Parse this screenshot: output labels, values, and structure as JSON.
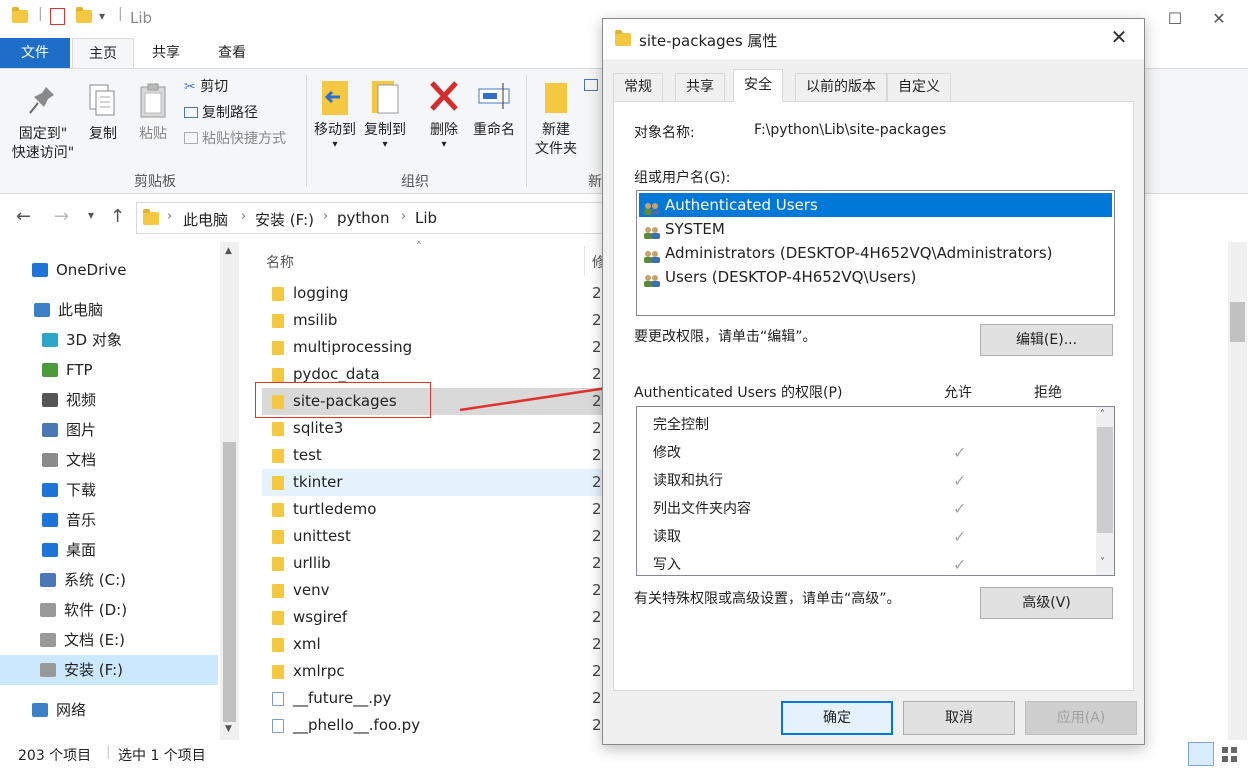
{
  "window": {
    "title": "Lib",
    "minimize": "—",
    "maximize": "☐",
    "close": "✕"
  },
  "ribbon_tabs": [
    "文件",
    "主页",
    "共享",
    "查看"
  ],
  "ribbon": {
    "pin": [
      "固定到\"",
      "快速访问\""
    ],
    "copy": "复制",
    "paste": "粘贴",
    "cut": "剪切",
    "copy_path": "复制路径",
    "paste_shortcut": "粘贴快捷方式",
    "clipboard_group": "剪贴板",
    "move_to": "移动到",
    "copy_to": "复制到",
    "delete": "删除",
    "rename": "重命名",
    "organize_group": "组织",
    "new_folder": [
      "新建",
      "文件夹"
    ],
    "new_group": "新"
  },
  "address": {
    "crumbs": [
      "此电脑",
      "安装 (F:)",
      "python",
      "Lib"
    ]
  },
  "sidebar": [
    {
      "label": "OneDrive",
      "icon": "cloud-icon"
    },
    {
      "label": "此电脑",
      "icon": "computer-icon"
    },
    {
      "label": "3D 对象",
      "icon": "cube-icon"
    },
    {
      "label": "FTP",
      "icon": "network-folder-icon"
    },
    {
      "label": "视频",
      "icon": "video-icon"
    },
    {
      "label": "图片",
      "icon": "picture-icon"
    },
    {
      "label": "文档",
      "icon": "document-icon"
    },
    {
      "label": "下载",
      "icon": "download-icon"
    },
    {
      "label": "音乐",
      "icon": "music-icon"
    },
    {
      "label": "桌面",
      "icon": "desktop-icon"
    },
    {
      "label": "系统 (C:)",
      "icon": "windows-drive-icon"
    },
    {
      "label": "软件 (D:)",
      "icon": "drive-icon"
    },
    {
      "label": "文档 (E:)",
      "icon": "drive-icon"
    },
    {
      "label": "安装 (F:)",
      "icon": "drive-icon"
    },
    {
      "label": "网络",
      "icon": "network-icon"
    }
  ],
  "filelist": {
    "column_name": "名称",
    "column_date_partial": "修",
    "date_partial": "2",
    "files": [
      {
        "name": "logging",
        "type": "folder"
      },
      {
        "name": "msilib",
        "type": "folder"
      },
      {
        "name": "multiprocessing",
        "type": "folder"
      },
      {
        "name": "pydoc_data",
        "type": "folder"
      },
      {
        "name": "site-packages",
        "type": "folder"
      },
      {
        "name": "sqlite3",
        "type": "folder"
      },
      {
        "name": "test",
        "type": "folder"
      },
      {
        "name": "tkinter",
        "type": "folder"
      },
      {
        "name": "turtledemo",
        "type": "folder"
      },
      {
        "name": "unittest",
        "type": "folder"
      },
      {
        "name": "urllib",
        "type": "folder"
      },
      {
        "name": "venv",
        "type": "folder"
      },
      {
        "name": "wsgiref",
        "type": "folder"
      },
      {
        "name": "xml",
        "type": "folder"
      },
      {
        "name": "xmlrpc",
        "type": "folder"
      },
      {
        "name": "__future__.py",
        "type": "py"
      },
      {
        "name": "__phello__.foo.py",
        "type": "py"
      }
    ]
  },
  "status": {
    "count": "203 个项目",
    "selected": "选中 1 个项目"
  },
  "dialog": {
    "title": "site-packages 属性",
    "close": "✕",
    "tabs": [
      "常规",
      "共享",
      "安全",
      "以前的版本",
      "自定义"
    ],
    "object_label": "对象名称:",
    "object_value": "F:\\python\\Lib\\site-packages",
    "group_label": "组或用户名(G):",
    "users": [
      "Authenticated Users",
      "SYSTEM",
      "Administrators (DESKTOP-4H652VQ\\Administrators)",
      "Users (DESKTOP-4H652VQ\\Users)"
    ],
    "edit_hint": "要更改权限，请单击“编辑”。",
    "edit_button": "编辑(E)...",
    "perm_label": "Authenticated Users 的权限(P)",
    "allow": "允许",
    "deny": "拒绝",
    "permissions": [
      {
        "name": "完全控制",
        "allow": ""
      },
      {
        "name": "修改",
        "allow": "✓"
      },
      {
        "name": "读取和执行",
        "allow": "✓"
      },
      {
        "name": "列出文件夹内容",
        "allow": "✓"
      },
      {
        "name": "读取",
        "allow": "✓"
      },
      {
        "name": "写入",
        "allow": "✓"
      }
    ],
    "advanced_hint": "有关特殊权限或高级设置，请单击“高级”。",
    "advanced_button": "高级(V)",
    "ok": "确定",
    "cancel": "取消",
    "apply": "应用(A)"
  },
  "colors": {
    "accent": "#0078d7",
    "file_tab": "#1e6ec7",
    "annotation": "#e0332f",
    "folder": "#f5c842"
  }
}
